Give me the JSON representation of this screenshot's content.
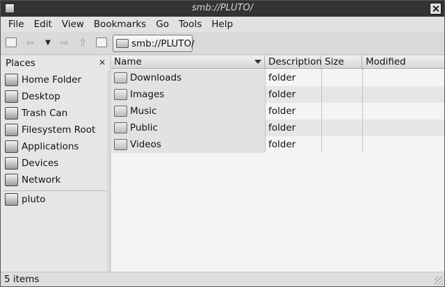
{
  "window": {
    "title": "smb://PLUTO/"
  },
  "menu": [
    "File",
    "Edit",
    "View",
    "Bookmarks",
    "Go",
    "Tools",
    "Help"
  ],
  "toolbar": {
    "path_button": "smb://PLUTO/"
  },
  "sidepane": {
    "header": "Places",
    "items": [
      {
        "label": "Home Folder",
        "icon": "home-folder-icon"
      },
      {
        "label": "Desktop",
        "icon": "desktop-icon"
      },
      {
        "label": "Trash Can",
        "icon": "trash-icon"
      },
      {
        "label": "Filesystem Root",
        "icon": "filesystem-icon"
      },
      {
        "label": "Applications",
        "icon": "applications-icon"
      },
      {
        "label": "Devices",
        "icon": "devices-icon"
      },
      {
        "label": "Network",
        "icon": "network-icon"
      }
    ],
    "bookmarks": [
      {
        "label": "pluto",
        "icon": "network-share-icon"
      }
    ]
  },
  "filelist": {
    "columns": [
      "Name",
      "Description",
      "Size",
      "Modified"
    ],
    "rows": [
      {
        "name": "Downloads",
        "description": "folder",
        "size": "",
        "modified": ""
      },
      {
        "name": "Images",
        "description": "folder",
        "size": "",
        "modified": ""
      },
      {
        "name": "Music",
        "description": "folder",
        "size": "",
        "modified": ""
      },
      {
        "name": "Public",
        "description": "folder",
        "size": "",
        "modified": ""
      },
      {
        "name": "Videos",
        "description": "folder",
        "size": "",
        "modified": ""
      }
    ]
  },
  "statusbar": {
    "text": "5 items"
  }
}
